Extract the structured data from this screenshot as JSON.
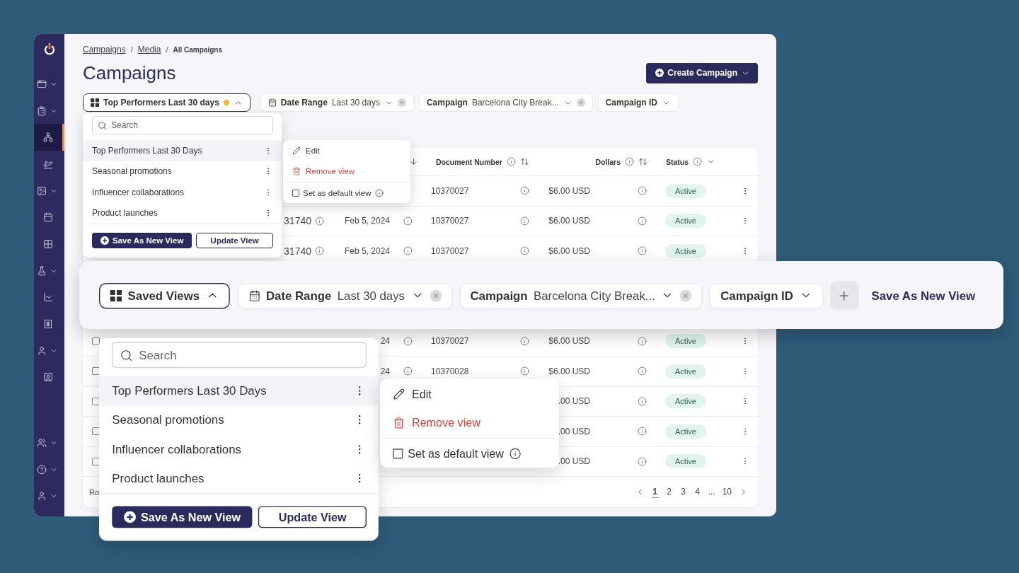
{
  "sidebar": {
    "items": [
      {
        "selected": false,
        "expandable": true
      },
      {
        "selected": false,
        "expandable": true
      },
      {
        "selected": true,
        "expandable": false
      },
      {
        "selected": false,
        "expandable": false
      },
      {
        "selected": false,
        "expandable": true
      },
      {
        "selected": false,
        "expandable": false
      },
      {
        "selected": false,
        "expandable": false
      },
      {
        "selected": false,
        "expandable": true
      },
      {
        "selected": false,
        "expandable": false
      },
      {
        "selected": false,
        "expandable": false
      },
      {
        "selected": false,
        "expandable": true
      },
      {
        "selected": false,
        "expandable": false
      }
    ],
    "bottom_items": [
      {
        "selected": false,
        "expandable": true
      },
      {
        "selected": false,
        "expandable": true
      },
      {
        "selected": false,
        "expandable": true
      }
    ]
  },
  "breadcrumb": {
    "separator": "/",
    "items": [
      {
        "label": "Campaigns",
        "link": true
      },
      {
        "label": "Media",
        "link": true
      },
      {
        "label": "All Campaigns",
        "link": false
      }
    ]
  },
  "title": "Campaigns",
  "create_button": "Create Campaign",
  "filter_bar": {
    "view": {
      "label": "Top Performers Last 30 days",
      "unsaved": true,
      "expanded": true
    },
    "chips": [
      {
        "kind": "date",
        "label": "Date Range",
        "value": "Last 30 days",
        "clearable": true
      },
      {
        "kind": "select",
        "label": "Campaign",
        "value": "Barcelona City Break...",
        "clearable": true
      },
      {
        "kind": "select",
        "label": "Campaign ID",
        "clearable": false
      }
    ]
  },
  "views_menu": {
    "search_placeholder": "Search",
    "items": [
      {
        "label": "Top Performers Last 30 Days",
        "selected": true
      },
      {
        "label": "Seasonal promotions",
        "selected": false
      },
      {
        "label": "Influencer collaborations",
        "selected": false
      },
      {
        "label": "Product launches",
        "selected": false
      }
    ],
    "save_button": "Save As New View",
    "update_button": "Update View"
  },
  "view_actions": {
    "items": [
      {
        "kind": "edit",
        "label": "Edit"
      },
      {
        "kind": "remove",
        "label": "Remove view"
      },
      {
        "kind": "checkbox",
        "label": "Set as default view",
        "checked": false
      }
    ]
  },
  "table": {
    "columns": [
      {
        "label": "Document Number",
        "kind": "sort"
      },
      {
        "label": "Dollars",
        "kind": "sort"
      },
      {
        "label": "Status",
        "kind": "filter"
      }
    ],
    "rows": [
      {
        "document_number": "10370027",
        "amount": "$6.00 USD",
        "status": "Active"
      },
      {
        "campaign_id": "31740",
        "date": "Feb 5, 2024",
        "document_number": "10370027",
        "amount": "$6.00 USD",
        "status": "Active"
      },
      {
        "campaign_id": "31740",
        "date": "Feb 5, 2024",
        "document_number": "10370027",
        "amount": "$6.00 USD",
        "status": "Active"
      },
      {
        "checked": false,
        "date": "24",
        "document_number": "10370027",
        "amount": "$6.00 USD",
        "status": "Active"
      },
      {
        "checked": false,
        "date": "24",
        "document_number": "10370028",
        "amount": "$6.00 USD",
        "status": "Active"
      },
      {
        "checked": false,
        "amount": ".00 USD",
        "status": "Active"
      },
      {
        "checked": false,
        "amount": ".00 USD",
        "status": "Active"
      },
      {
        "checked": false,
        "amount": ".00 USD",
        "status": "Active"
      }
    ],
    "footer_label": "Ro",
    "pages": [
      {
        "label": "1",
        "selected": true
      },
      {
        "label": "2",
        "selected": false
      },
      {
        "label": "3",
        "selected": false
      },
      {
        "label": "4",
        "selected": false
      },
      {
        "label": "...",
        "selected": false
      },
      {
        "label": "10",
        "selected": false
      }
    ]
  },
  "zoom_bar": {
    "view": {
      "label": "Saved Views",
      "unsaved": false,
      "expanded": true
    },
    "chips": [
      {
        "kind": "date",
        "label": "Date Range",
        "value": "Last 30 days",
        "clearable": true
      },
      {
        "kind": "select",
        "label": "Campaign",
        "value": "Barcelona City Break...",
        "clearable": true
      },
      {
        "kind": "select",
        "label": "Campaign ID",
        "clearable": false
      }
    ],
    "save_link": "Save As New View"
  },
  "zoom_views_menu": {
    "search_placeholder": "Search",
    "items": [
      {
        "label": "Top Performers Last 30 Days",
        "selected": true
      },
      {
        "label": "Seasonal promotions",
        "selected": false
      },
      {
        "label": "Influencer collaborations",
        "selected": false
      },
      {
        "label": "Product launches",
        "selected": false
      }
    ],
    "save_button": "Save As New View",
    "update_button": "Update View"
  },
  "zoom_view_actions": {
    "items": [
      {
        "kind": "edit",
        "label": "Edit"
      },
      {
        "kind": "remove",
        "label": "Remove view"
      },
      {
        "kind": "checkbox",
        "label": "Set as default view",
        "checked": false
      }
    ]
  }
}
